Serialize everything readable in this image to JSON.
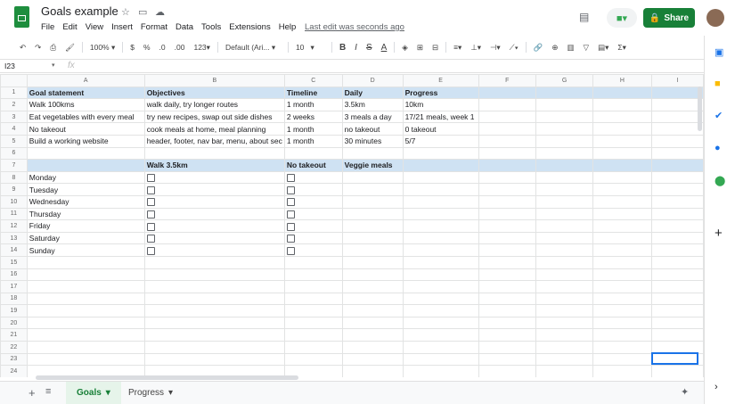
{
  "app": {
    "title": "Goals example",
    "menu": [
      "File",
      "Edit",
      "View",
      "Insert",
      "Format",
      "Data",
      "Tools",
      "Extensions",
      "Help"
    ],
    "last_edit": "Last edit was seconds ago",
    "share_label": "Share"
  },
  "toolbar": {
    "zoom": "100%",
    "currency": "$",
    "percent": "%",
    "dec_less": ".0",
    "dec_more": ".00",
    "format": "123",
    "font": "Default (Ari...",
    "font_size": "10",
    "bold": "B",
    "italic": "I",
    "strike": "S",
    "text_color": "A"
  },
  "formula_bar": {
    "cell_ref": "I23",
    "fx": "fx",
    "value": ""
  },
  "grid": {
    "columns": [
      "A",
      "B",
      "C",
      "D",
      "E",
      "F",
      "G",
      "H",
      "I"
    ],
    "rows": [
      [
        "Goal statement",
        "Objectives",
        "Timeline",
        "Daily",
        "Progress",
        "",
        "",
        "",
        ""
      ],
      [
        "Walk 100kms",
        "walk daily, try longer routes",
        "1 month",
        "3.5km",
        "10km",
        "",
        "",
        "",
        ""
      ],
      [
        "Eat vegetables with every meal",
        "try new recipes, swap out side dishes",
        "2 weeks",
        "3 meals a day",
        "17/21 meals, week 1",
        "",
        "",
        "",
        ""
      ],
      [
        "No takeout",
        "cook meals at home, meal planning",
        "1 month",
        "no takeout",
        "0 takeout",
        "",
        "",
        "",
        ""
      ],
      [
        "Build a working website",
        "header, footer, nav bar, menu, about sec",
        "1 month",
        "30 minutes",
        "5/7",
        "",
        "",
        "",
        ""
      ],
      [
        "",
        "",
        "",
        "",
        "",
        "",
        "",
        "",
        ""
      ],
      [
        "",
        "Walk 3.5km",
        "No takeout",
        "Veggie meals",
        "",
        "",
        "",
        "",
        ""
      ],
      [
        "Monday",
        "[]",
        "[]",
        "",
        "",
        "",
        "",
        "",
        ""
      ],
      [
        "Tuesday",
        "[]",
        "[]",
        "",
        "",
        "",
        "",
        "",
        ""
      ],
      [
        "Wednesday",
        "[]",
        "[]",
        "",
        "",
        "",
        "",
        "",
        ""
      ],
      [
        "Thursday",
        "[]",
        "[]",
        "",
        "",
        "",
        "",
        "",
        ""
      ],
      [
        "Friday",
        "[]",
        "[]",
        "",
        "",
        "",
        "",
        "",
        ""
      ],
      [
        "Saturday",
        "[]",
        "[]",
        "",
        "",
        "",
        "",
        "",
        ""
      ],
      [
        "Sunday",
        "[]",
        "[]",
        "",
        "",
        "",
        "",
        "",
        ""
      ],
      [
        "",
        "",
        "",
        "",
        "",
        "",
        "",
        "",
        ""
      ],
      [
        "",
        "",
        "",
        "",
        "",
        "",
        "",
        "",
        ""
      ],
      [
        "",
        "",
        "",
        "",
        "",
        "",
        "",
        "",
        ""
      ],
      [
        "",
        "",
        "",
        "",
        "",
        "",
        "",
        "",
        ""
      ],
      [
        "",
        "",
        "",
        "",
        "",
        "",
        "",
        "",
        ""
      ],
      [
        "",
        "",
        "",
        "",
        "",
        "",
        "",
        "",
        ""
      ],
      [
        "",
        "",
        "",
        "",
        "",
        "",
        "",
        "",
        ""
      ],
      [
        "",
        "",
        "",
        "",
        "",
        "",
        "",
        "",
        ""
      ],
      [
        "",
        "",
        "",
        "",
        "",
        "",
        "",
        "",
        ""
      ],
      [
        "",
        "",
        "",
        "",
        "",
        "",
        "",
        "",
        ""
      ]
    ],
    "highlight_rows": [
      1,
      7
    ]
  },
  "sheets": [
    {
      "label": "Goals",
      "active": true
    },
    {
      "label": "Progress",
      "active": false
    }
  ]
}
